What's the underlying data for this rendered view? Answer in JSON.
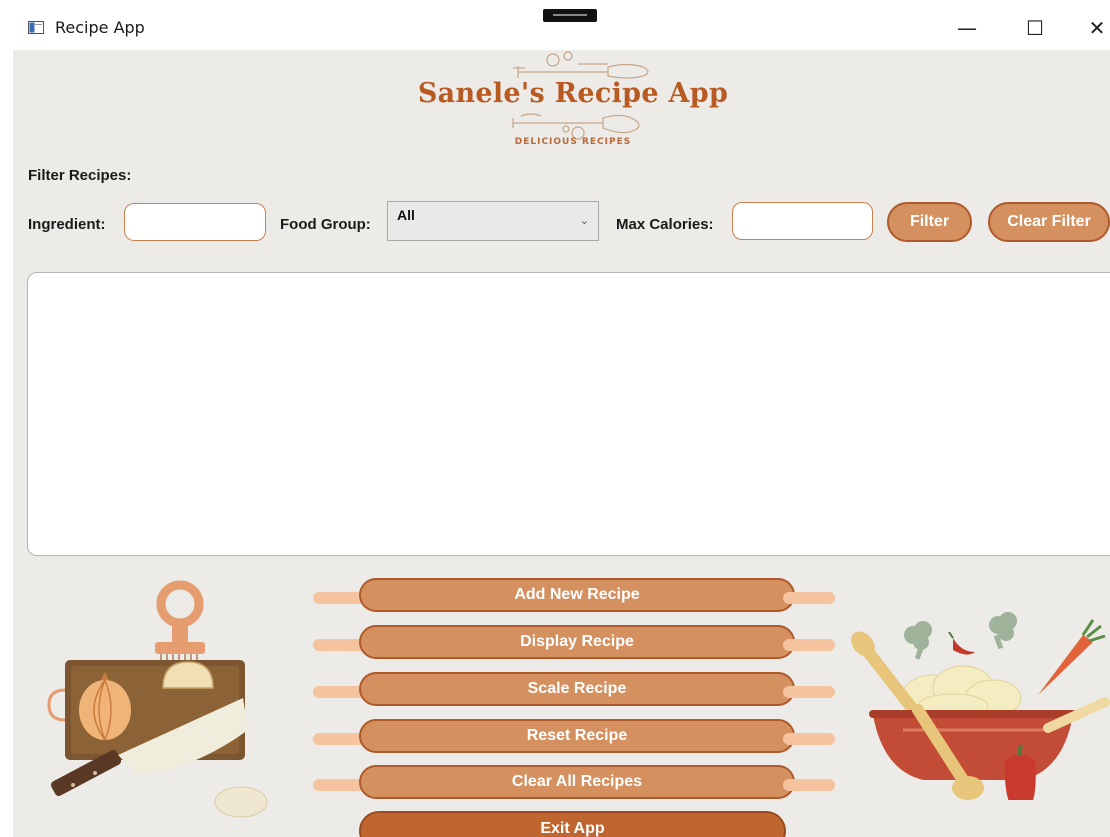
{
  "window": {
    "title": "Recipe App",
    "icon": "app-window-icon",
    "controls": {
      "minimize": "—",
      "maximize": "☐",
      "close": "✕"
    }
  },
  "header": {
    "title": "Sanele's Recipe App",
    "subtitle": "DELICIOUS RECIPES"
  },
  "filter": {
    "heading": "Filter Recipes:",
    "ingredient_label": "Ingredient:",
    "ingredient_value": "",
    "food_group_label": "Food Group:",
    "food_group_value": "All",
    "max_calories_label": "Max Calories:",
    "max_calories_value": "",
    "filter_button": "Filter",
    "clear_filter_button": "Clear Filter"
  },
  "recipe_list": {
    "items": []
  },
  "actions": {
    "add": "Add New Recipe",
    "display": "Display Recipe",
    "scale": "Scale Recipe",
    "reset": "Reset Recipe",
    "clear_all": "Clear All Recipes",
    "exit": "Exit App"
  },
  "colors": {
    "background": "#ecebe7",
    "button_fill": "#d4905f",
    "button_border": "#ae5a2b",
    "accent": "#b85a22",
    "exit_fill": "#bf6530"
  }
}
